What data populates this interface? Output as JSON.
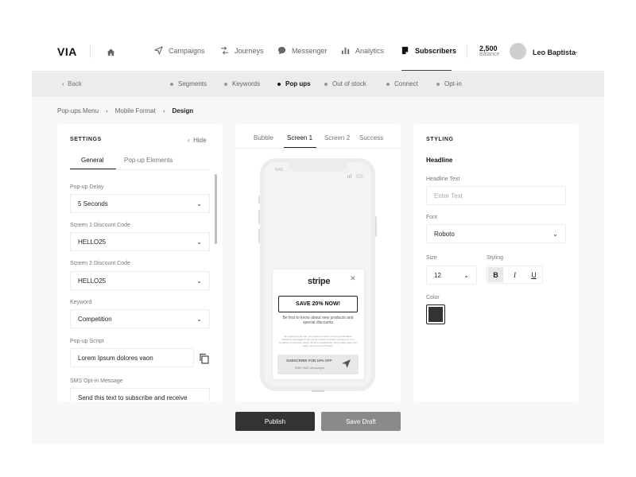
{
  "app": {
    "logo": "VIA"
  },
  "nav": {
    "items": [
      {
        "label": "Campaigns",
        "icon": "send-icon"
      },
      {
        "label": "Journeys",
        "icon": "shuffle-icon"
      },
      {
        "label": "Messenger",
        "icon": "chat-icon"
      },
      {
        "label": "Analytics",
        "icon": "bar-chart-icon"
      },
      {
        "label": "Subscribers",
        "icon": "subscribers-icon",
        "active": true
      }
    ],
    "balance_value": "2,500",
    "balance_label": "Balance",
    "user_name": "Leo Baptista"
  },
  "subnav": {
    "back_label": "Back",
    "steps": [
      {
        "label": "Segments"
      },
      {
        "label": "Keywords"
      },
      {
        "label": "Pop ups",
        "active": true
      },
      {
        "label": "Out of stock"
      },
      {
        "label": "Connect"
      },
      {
        "label": "Opt-in"
      }
    ]
  },
  "breadcrumb": [
    "Pop-ups Menu",
    "Mobile Format",
    "Design"
  ],
  "settings": {
    "title": "SETTINGS",
    "hide_label": "Hide",
    "tabs": [
      "General",
      "Pop-up Elements"
    ],
    "fields": [
      {
        "label": "Pop-up Delay",
        "value": "5 Seconds"
      },
      {
        "label": "Screen 1 Discount Code",
        "value": "HELLO25"
      },
      {
        "label": "Screen 2 Discount Code",
        "value": "HELLO25"
      },
      {
        "label": "Keyword",
        "value": "Competition"
      },
      {
        "label": "Pop-up Script",
        "value": "Lorem Ipsum dolores vaon"
      },
      {
        "label": "SMS Opt-in Message",
        "value": "Send this text to subscribe and receive"
      }
    ]
  },
  "preview": {
    "tabs": [
      "Bubble",
      "Screen 1",
      "Screen 2",
      "Success"
    ],
    "phone_time": "9:41",
    "popup": {
      "brand": "stripe",
      "cta": "SAVE 20% NOW!",
      "desc": "Be first to know about new products and special discounts",
      "fine_print": "By signing up via text, you agree to receive recurring automated marketing messages at the phone number provided. Consent is not a condition of purchase. Reply STOP to unsubscribe. Msg & data rates may apply. View Terms & Privacy.",
      "subscribe_title": "SUBSCRIBE FOR 10% OFF",
      "subscribe_sub": "With SMS Messages"
    }
  },
  "styling": {
    "title": "STYLING",
    "headline_heading": "Headline",
    "headline_text_label": "Headline Text",
    "headline_placeholder": "Enter Text",
    "font_label": "Font",
    "font_value": "Roboto",
    "size_label": "Size",
    "size_value": "12",
    "styling_label": "Styling",
    "format_buttons": [
      "B",
      "I",
      "U"
    ],
    "color_label": "Color",
    "color_value": "#333333"
  },
  "actions": {
    "publish": "Publish",
    "save_draft": "Save Draft"
  }
}
